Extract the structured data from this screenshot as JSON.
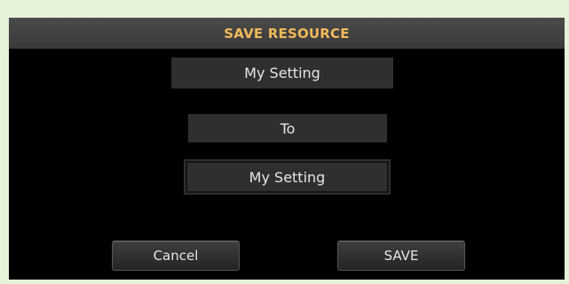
{
  "dialog": {
    "title": "SAVE RESOURCE",
    "source_name": "My Setting",
    "to_label": "To",
    "destination_name": "My Setting",
    "cancel_label": "Cancel",
    "save_label": "SAVE"
  },
  "colors": {
    "title_text": "#f1b95a",
    "background": "#000000",
    "field_background": "#2f2f2f",
    "frame_border": "#e3f2d8"
  }
}
